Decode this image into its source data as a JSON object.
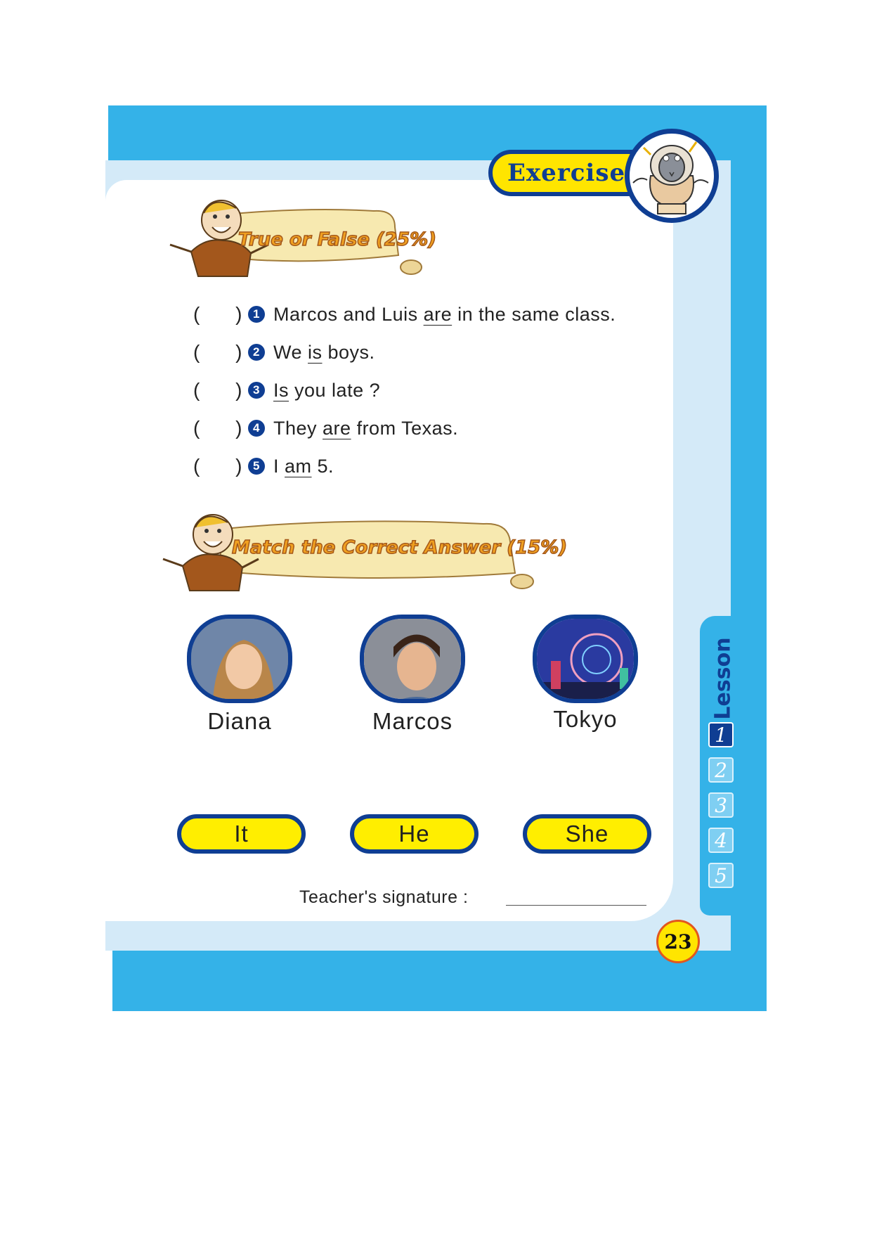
{
  "header": {
    "exercise_label": "Exercise"
  },
  "sections": {
    "true_false": {
      "title": "True or False (25%)"
    },
    "match": {
      "title": "Match the Correct Answer (15%)"
    }
  },
  "tf_items": [
    {
      "number": "1",
      "before": "Marcos and Luis ",
      "underlined": "are",
      "after": " in the same class."
    },
    {
      "number": "2",
      "before": "We ",
      "underlined": "is",
      "after": " boys."
    },
    {
      "number": "3",
      "before": "",
      "underlined": "Is",
      "after": " you late ?"
    },
    {
      "number": "4",
      "before": "They ",
      "underlined": "are",
      "after": " from Texas."
    },
    {
      "number": "5",
      "before": "I ",
      "underlined": "am",
      "after": " 5."
    }
  ],
  "paren_open": "(",
  "paren_close": ")",
  "photos": [
    {
      "label": "Diana",
      "image": "girl-photo"
    },
    {
      "label": "Marcos",
      "image": "boy-photo"
    },
    {
      "label": "Tokyo",
      "image": "ferris-wheel-photo"
    }
  ],
  "answers": [
    "It",
    "He",
    "She"
  ],
  "signature_label": "Teacher's signature :",
  "lesson": {
    "title": "Lesson",
    "numbers": [
      "1",
      "2",
      "3",
      "4",
      "5"
    ],
    "active": "1"
  },
  "page_number": "23",
  "colors": {
    "frame_blue": "#34b2e8",
    "navy": "#0f3e93",
    "yellow": "#ffe500",
    "banner_orange": "#f0a020"
  }
}
